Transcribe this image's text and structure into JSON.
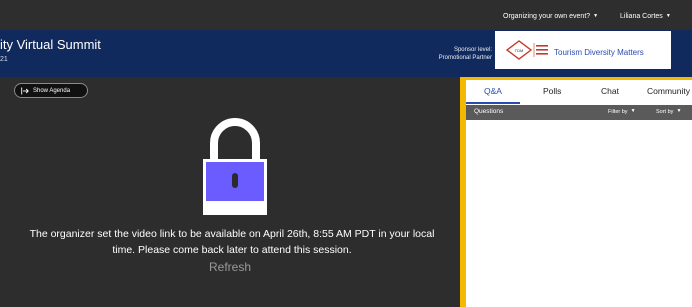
{
  "topbar": {
    "org_menu_label": "Organizing your own event?",
    "user_name": "Liliana Cortes"
  },
  "header": {
    "title": "ity Virtual Summit",
    "subtitle": "21",
    "sponsor_level_line1": "Sponsor level:",
    "sponsor_level_line2": "Promotional Partner",
    "sponsor_name": "Tourism Diversity Matters",
    "sponsor_logo_text": "TDM"
  },
  "video": {
    "agenda_button_label": "Show Agenda",
    "message_line1": "The organizer set the video link to be available on April 26th, 8:55 AM PDT in your local",
    "message_line2": "time. Please come back later to attend this session.",
    "refresh_label": "Refresh"
  },
  "panel": {
    "tabs": [
      {
        "label": "Q&A"
      },
      {
        "label": "Polls"
      },
      {
        "label": "Chat"
      },
      {
        "label": "Community"
      }
    ],
    "questions_label": "Questions",
    "filter_label": "Filter by",
    "sort_label": "Sort by"
  },
  "colors": {
    "header_bg": "#102a5e",
    "accent_yellow": "#f5b800",
    "lock_body": "#6a5cff",
    "tab_active": "#2a4bb3"
  },
  "icons": {
    "agenda": "expand-arrow-icon",
    "lock": "padlock-icon",
    "sponsor": "tdm-logo-icon"
  }
}
